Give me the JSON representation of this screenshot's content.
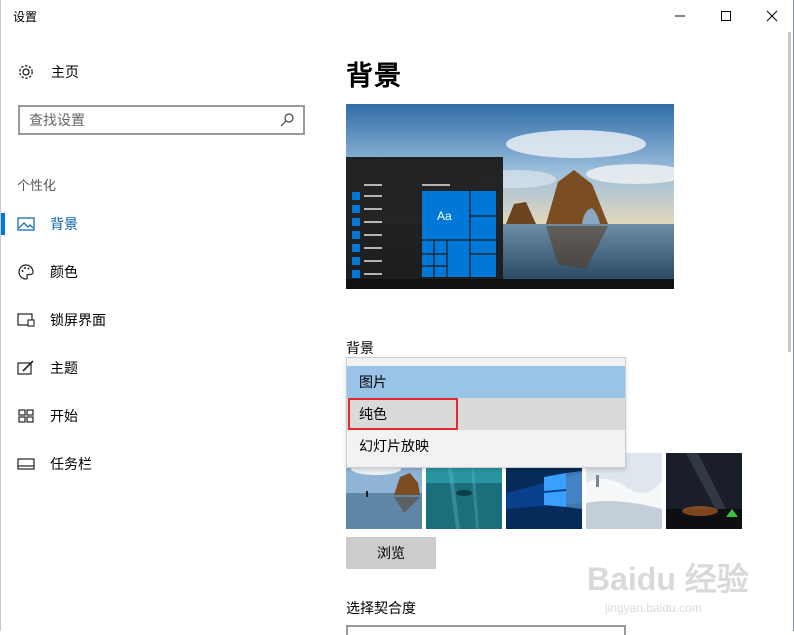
{
  "window": {
    "title": "设置"
  },
  "sidebar": {
    "home_label": "主页",
    "search_placeholder": "查找设置",
    "section_title": "个性化",
    "items": [
      {
        "label": "背景",
        "icon": "picture-icon",
        "active": true
      },
      {
        "label": "颜色",
        "icon": "palette-icon",
        "active": false
      },
      {
        "label": "锁屏界面",
        "icon": "lock-screen-icon",
        "active": false
      },
      {
        "label": "主题",
        "icon": "theme-brush-icon",
        "active": false
      },
      {
        "label": "开始",
        "icon": "start-tiles-icon",
        "active": false
      },
      {
        "label": "任务栏",
        "icon": "taskbar-icon",
        "active": false
      }
    ]
  },
  "main": {
    "heading": "背景",
    "preview_tile_text": "Aa",
    "background_label": "背景",
    "dropdown": {
      "options": [
        "图片",
        "纯色",
        "幻灯片放映"
      ],
      "selected": "图片",
      "hovered": "纯色"
    },
    "browse_label": "浏览",
    "fit_label": "选择契合度"
  },
  "watermark": {
    "text": "Baidu 经验",
    "sub": "jingyan.baidu.com"
  },
  "colors": {
    "accent": "#0078d7",
    "highlight": "#99c4e8",
    "annotation": "#e2292f"
  }
}
